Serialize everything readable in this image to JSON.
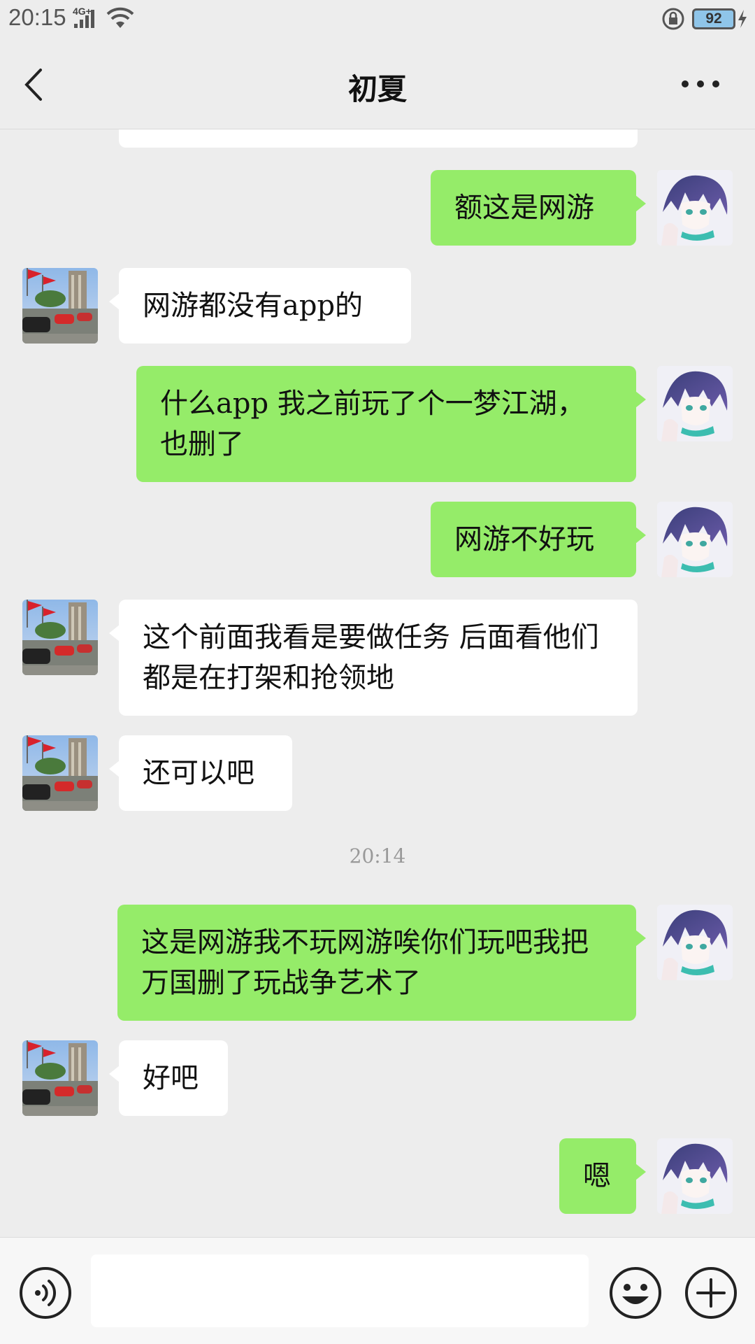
{
  "status_bar": {
    "time": "20:15",
    "network": "4G+",
    "battery": "92"
  },
  "header": {
    "title": "初夏"
  },
  "messages": [
    {
      "side": "out",
      "text": "额这是网游"
    },
    {
      "side": "in",
      "text": "网游都没有app的"
    },
    {
      "side": "out",
      "text": "什么app 我之前玩了个一梦江湖，也删了"
    },
    {
      "side": "out",
      "text": "网游不好玩"
    },
    {
      "side": "in",
      "text": "这个前面我看是要做任务 后面看他们都是在打架和抢领地"
    },
    {
      "side": "in",
      "text": "还可以吧"
    },
    {
      "timestamp": "20:14"
    },
    {
      "side": "out",
      "text": "这是网游我不玩网游唉你们玩吧我把万国删了玩战争艺术了"
    },
    {
      "side": "in",
      "text": "好吧"
    },
    {
      "side": "out",
      "text": "嗯"
    }
  ],
  "colors": {
    "background": "#ededed",
    "bubble_out": "#95ec69",
    "bubble_in": "#ffffff"
  },
  "icons": {
    "back": "chevron-left-icon",
    "more": "more-dots-icon",
    "voice": "voice-icon",
    "emoji": "emoji-icon",
    "plus": "plus-icon"
  }
}
